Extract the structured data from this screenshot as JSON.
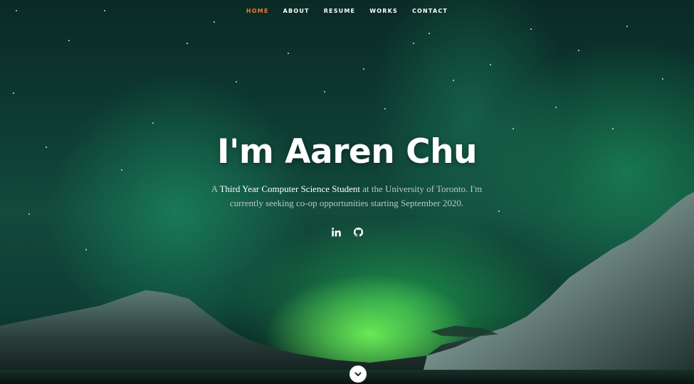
{
  "nav": {
    "items": [
      {
        "label": "HOME",
        "active": true
      },
      {
        "label": "ABOUT",
        "active": false
      },
      {
        "label": "RESUME",
        "active": false
      },
      {
        "label": "WORKS",
        "active": false
      },
      {
        "label": "CONTACT",
        "active": false
      }
    ],
    "active_color": "#f07a38"
  },
  "hero": {
    "title": "I'm Aaren Chu",
    "subtitle_prefix": "A ",
    "subtitle_highlight": "Third Year Computer Science Student",
    "subtitle_rest": " at the University of Toronto. I'm currently seeking co-op opportunities starting September 2020."
  },
  "social": {
    "icons": [
      "linkedin-icon",
      "github-icon"
    ]
  },
  "scroll": {
    "icon": "chevron-down-icon"
  }
}
